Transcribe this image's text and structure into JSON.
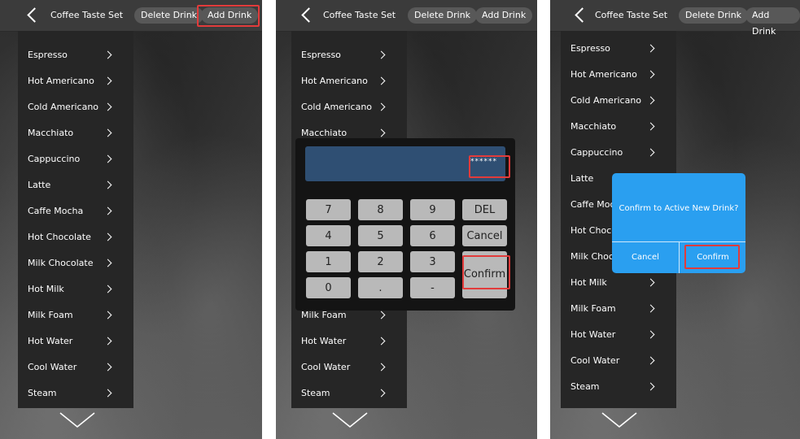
{
  "header": {
    "title": "Coffee Taste Set",
    "delete_label": "Delete Drink",
    "add_label": "Add Drink"
  },
  "menu": [
    "Espresso",
    "Hot Americano",
    "Cold Americano",
    "Macchiato",
    "Cappuccino",
    "Latte",
    "Caffe Mocha",
    "Hot Chocolate",
    "Milk Chocolate",
    "Hot Milk",
    "Milk Foam",
    "Hot Water",
    "Cool Water",
    "Steam"
  ],
  "panel2_visible": {
    "top_items": [
      "Espresso",
      "Hot Americano",
      "Cold Americano",
      "Macchiato"
    ],
    "partial_item": "Milk Foam",
    "bottom_items": [
      "Hot Water",
      "Cool Water",
      "Steam"
    ]
  },
  "panel3_truncated": {
    "latte": "Latte",
    "caffe_mocha": "Caffe Moc",
    "hot_chocolate": "Hot Choco",
    "milk_chocolate": "Milk Choco"
  },
  "keypad": {
    "password_mask": "******",
    "keys": [
      [
        "7",
        "8",
        "9",
        "DEL"
      ],
      [
        "4",
        "5",
        "6",
        "Cancel"
      ],
      [
        "1",
        "2",
        "3",
        "Confirm"
      ],
      [
        "0",
        ".",
        "-"
      ]
    ]
  },
  "dialog": {
    "message": "Confirm to Active New Drink?",
    "cancel_label": "Cancel",
    "confirm_label": "Confirm"
  },
  "colors": {
    "highlight": "#e23b3b",
    "dialog_bg": "#2a9ff0",
    "pw_field": "#2f4f73",
    "key_bg": "#b9b9b9"
  }
}
